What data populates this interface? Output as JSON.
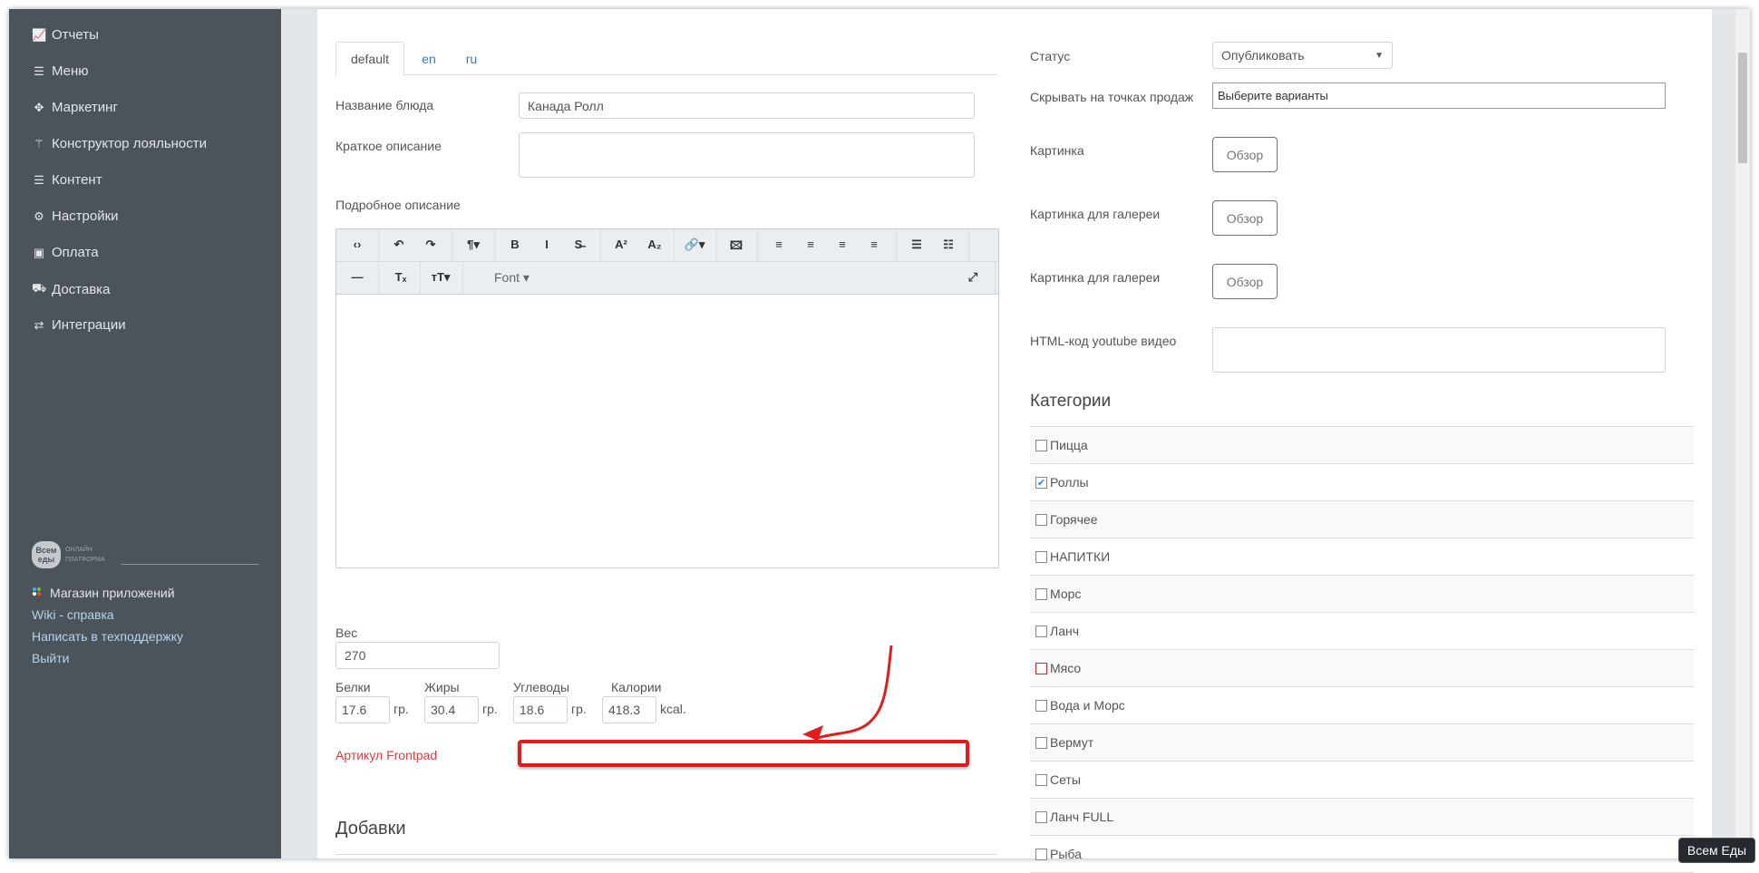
{
  "sidebar": {
    "items": [
      {
        "label": "Отчеты",
        "icon": "chart-line-icon"
      },
      {
        "label": "Меню",
        "icon": "list-icon"
      },
      {
        "label": "Маркетинг",
        "icon": "crosshairs-icon"
      },
      {
        "label": "Конструктор лояльности",
        "icon": "magic-wand-icon"
      },
      {
        "label": "Контент",
        "icon": "list-icon"
      },
      {
        "label": "Настройки",
        "icon": "gear-icon"
      },
      {
        "label": "Оплата",
        "icon": "money-icon"
      },
      {
        "label": "Доставка",
        "icon": "truck-icon"
      },
      {
        "label": "Интеграции",
        "icon": "exchange-icon"
      }
    ],
    "logo": {
      "brand": "Всем еды",
      "line1": "ОНЛАЙН",
      "line2": "ПЛАТФОРМА"
    },
    "links": [
      "Магазин приложений",
      "Wiki - справка",
      "Написать в техподдержку",
      "Выйти"
    ]
  },
  "tabs": [
    "default",
    "en",
    "ru"
  ],
  "form": {
    "name_label": "Название блюда",
    "name_value": "Канада Ролл",
    "short_label": "Краткое описание",
    "long_label": "Подробное описание",
    "font_label": "Font",
    "weight_label": "Вес",
    "weight_value": "270",
    "nutrition": [
      {
        "label": "Белки",
        "value": "17.6",
        "unit": "гр."
      },
      {
        "label": "Жиры",
        "value": "30.4",
        "unit": "гр."
      },
      {
        "label": "Углеводы",
        "value": "18.6",
        "unit": "гр."
      },
      {
        "label": "Калории",
        "value": "418.3",
        "unit": "kcal."
      }
    ],
    "article_label": "Артикул Frontpad",
    "article_value": "",
    "addons_title": "Добавки"
  },
  "right": {
    "status_label": "Статус",
    "status_value": "Опубликовать",
    "hide_label": "Скрывать на точках продаж",
    "hide_placeholder": "Выберите варианты",
    "image_label": "Картинка",
    "gallery1_label": "Картинка для галереи",
    "gallery2_label": "Картинка для галереи",
    "browse": "Обзор",
    "youtube_label": "HTML-код youtube видео",
    "categories_title": "Категории",
    "categories": [
      {
        "label": "Пицца",
        "checked": false
      },
      {
        "label": "Роллы",
        "checked": true
      },
      {
        "label": "Горячее",
        "checked": false
      },
      {
        "label": "НАПИТКИ",
        "checked": false
      },
      {
        "label": "Морс",
        "checked": false
      },
      {
        "label": "Ланч",
        "checked": false
      },
      {
        "label": "Мясо",
        "checked": false,
        "highlight": true
      },
      {
        "label": "Вода и Морс",
        "checked": false
      },
      {
        "label": "Вермут",
        "checked": false
      },
      {
        "label": "Сеты",
        "checked": false
      },
      {
        "label": "Ланч FULL",
        "checked": false
      },
      {
        "label": "Рыба",
        "checked": false
      }
    ]
  },
  "tooltip": "Всем Еды",
  "colors": {
    "sidebar": "#4b535b",
    "accent": "#337ab7",
    "annotation": "#e31b1b",
    "article_label": "#e8383d"
  }
}
